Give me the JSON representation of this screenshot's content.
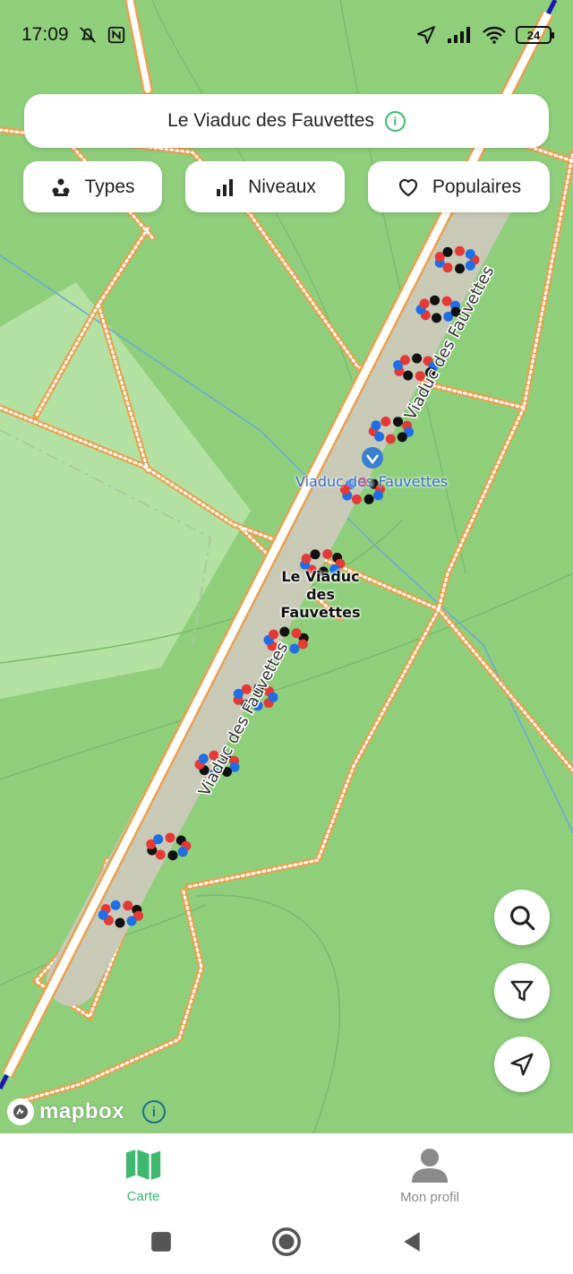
{
  "status_bar": {
    "time": "17:09",
    "battery": "24",
    "icons": [
      "mute-bell-icon",
      "nfc-icon",
      "location-arrow-icon",
      "signal-icon",
      "wifi-icon",
      "battery-icon"
    ]
  },
  "header": {
    "title": "Le Viaduc des Fauvettes",
    "info_badge": "i"
  },
  "filters": [
    {
      "label": "Types",
      "icon": "types-icon"
    },
    {
      "label": "Niveaux",
      "icon": "bars-icon"
    },
    {
      "label": "Populaires",
      "icon": "heart-icon"
    }
  ],
  "map": {
    "labels": {
      "road_upper": "Viaduc des Fauvettes",
      "road_lower": "Viaduc des Fauvettes",
      "poi_name": "Viaduc des Fauvettes",
      "site_line1": "Le Viaduc des",
      "site_line2": "Fauvettes"
    },
    "attribution": "mapbox",
    "colors": {
      "grass": "#8fcf7c",
      "path": "#e9a14e",
      "road": "#ffffff",
      "rail": "#1a1ab0",
      "water": "#6aa6d8",
      "poi": "#3a7fd0"
    }
  },
  "map_controls": [
    {
      "name": "search",
      "icon": "search-icon"
    },
    {
      "name": "filter",
      "icon": "filter-icon"
    },
    {
      "name": "locate",
      "icon": "navigation-arrow-icon"
    }
  ],
  "bottom_nav": [
    {
      "label": "Carte",
      "icon": "map-icon",
      "active": true,
      "color": "#3cba6e"
    },
    {
      "label": "Mon profil",
      "icon": "user-icon",
      "active": false,
      "color": "#8a8a8a"
    }
  ],
  "system_nav": [
    "recents-button",
    "home-button",
    "back-button"
  ]
}
